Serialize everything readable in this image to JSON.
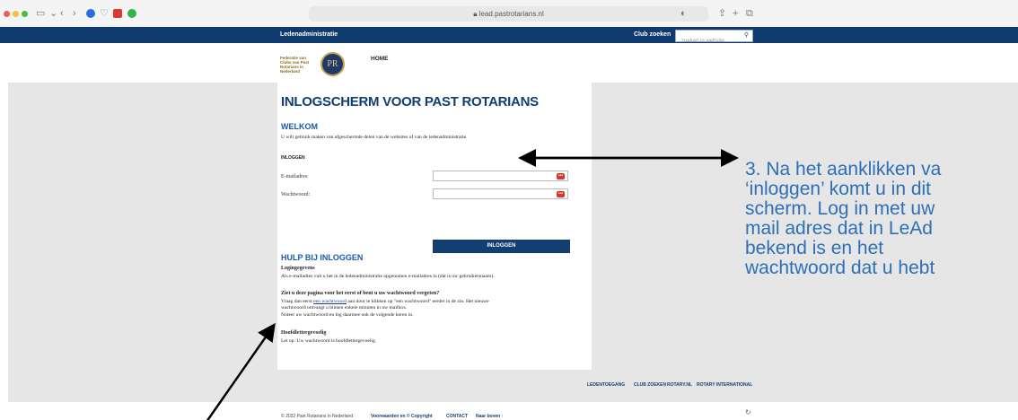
{
  "browser": {
    "address": "lead.pastrotarians.nl",
    "lock_icon": "lock-icon"
  },
  "site": {
    "brand_link": "Ledenadministratie",
    "club_search": "Club zoeken",
    "search_placeholder": "zoeken in website",
    "logo_text": "Federatie van Clubs van Past Rotarians in Nederland",
    "logo_monogram": "PR",
    "nav_home": "HOME"
  },
  "login": {
    "title": "INLOGSCHERM VOOR PAST ROTARIANS",
    "welcome_heading": "WELKOM",
    "welcome_text": "U wilt gebruik maken van afgeschermde delen van de websites of van de ledenadministratie.",
    "section_label": "INLOGGEN",
    "email_label": "E-mailadres:",
    "password_label": "Wachtwoord:",
    "submit_label": "INLOGGEN"
  },
  "help": {
    "heading": "HULP BIJ INLOGGEN",
    "q1_title": "Logingegevens",
    "q1_text": "Als e-mailadres vult u het in de ledenadministratie opgenomen e-mailadres in (dat is uw gebruikersnaam).",
    "q2_title": "Ziet u deze pagina voor het eerst of bent u uw wachtwoord vergeten?",
    "q2_text_a": "Vraag dan eerst",
    "q2_link": "een wachtwoord",
    "q2_text_b": "aan door te klikken op \"een wachtwoord\" eerder in de zin. Het nieuwe",
    "q2_line2": "wachtwoord ontvangt u binnen enkele minuten in uw mailbox.",
    "q2_line3": "Noteer uw wachtwoord en log daarmee ook de volgende keren in.",
    "q3_title": "Hoofdlettergevoelig",
    "q3_text": "Let op: Uw wachtwoord is hoofdlettergevoelig."
  },
  "footer": {
    "links": [
      "LEDENTOEGANG",
      "CLUB ZOEKEN",
      "ROTARY.NL",
      "ROTARY INTERNATIONAL"
    ],
    "copyright": "© 2022 Past Rotarians in Nederland",
    "terms": "Voorwaarden en © Copyright",
    "contact": "CONTACT",
    "top": "Naar boven ↑"
  },
  "annotation": {
    "lines": [
      "3. Na het aanklikken va",
      "‘inloggen’ komt u in dit",
      "scherm. Log in met uw",
      "mail adres dat in LeAd",
      "bekend is en het",
      "wachtwoord dat u hebt"
    ],
    "color": "#2d6fb7"
  }
}
